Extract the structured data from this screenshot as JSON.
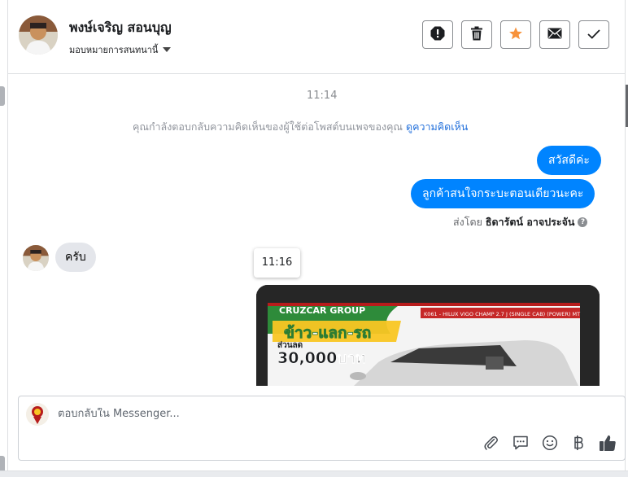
{
  "header": {
    "contact_name": "พงษ์เจริญ สอนบุญ",
    "assign_label": "มอบหมายการสนทนานี้",
    "toolbar": [
      "spam-icon",
      "trash-icon",
      "star-icon",
      "envelope-icon",
      "check-icon"
    ],
    "star_color": "#f7923b"
  },
  "conversation": {
    "time_1": "11:14",
    "notice_text": "คุณกำลังตอบกลับความคิดเห็นของผู้ใช้ต่อโพสต์บนเพจของคุณ",
    "notice_link": "ดูความคิดเห็น",
    "outgoing": [
      "สวัสดีค่ะ",
      "ลูกค้าสนใจกระบะตอนเดียวนะคะ"
    ],
    "sent_by_prefix": "ส่งโดย",
    "sent_by_name": "ธิดารัตน์ อาจประจัน",
    "incoming": "ครับ",
    "tooltip_time": "11:16",
    "bubble_color": "#0084ff",
    "attachment": {
      "banner": "CRUZCAR GROUP",
      "tag": "K061 - HILUX VIGO CHAMP 2.7 J (SINGLE CAB) (POWER) MT",
      "promo_line": "ข้าว-แลก-รถ",
      "discount_prefix": "ส่วนลด",
      "discount_value": "30,000บาท"
    }
  },
  "composer": {
    "placeholder": "ตอบกลับใน Messenger...",
    "icons": [
      "paperclip-icon",
      "saved-reply-icon",
      "emoji-icon",
      "baht-icon",
      "thumbs-up-icon"
    ]
  }
}
